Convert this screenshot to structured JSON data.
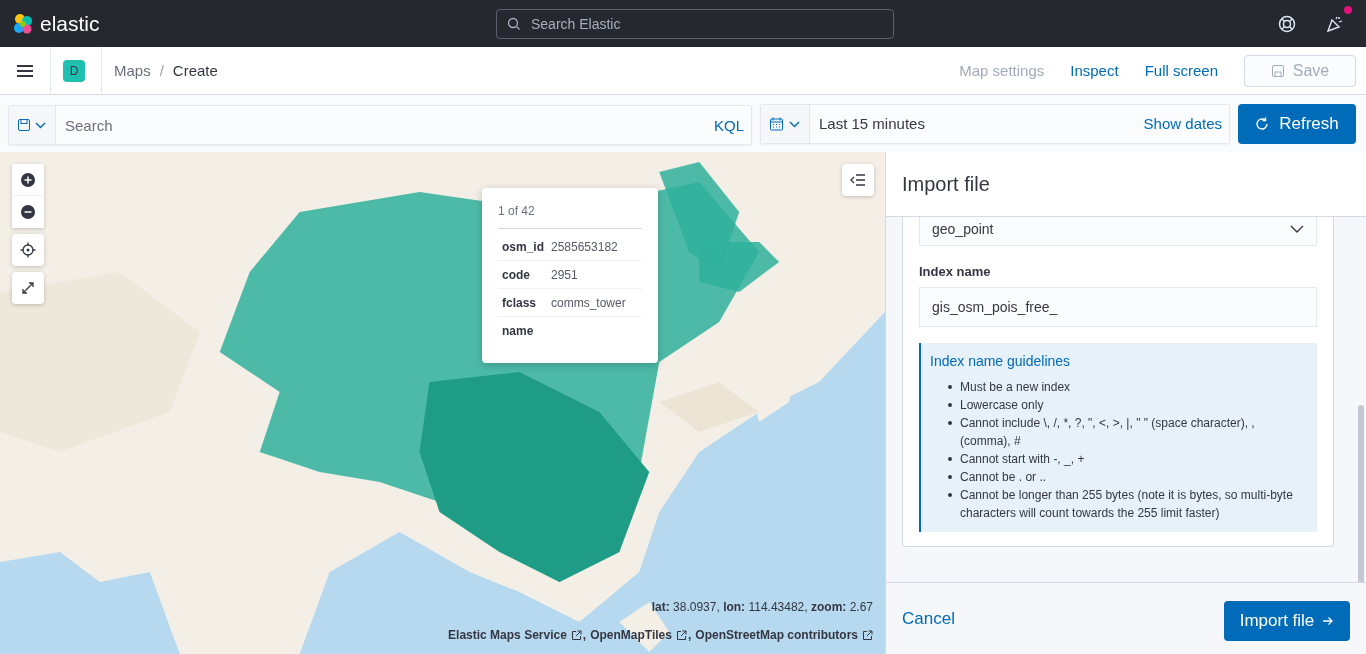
{
  "header": {
    "logo_text": "elastic",
    "search": {
      "placeholder": "Search Elastic"
    },
    "news_unread": true
  },
  "nav": {
    "space_initial": "D",
    "breadcrumb_separator": "/",
    "breadcrumbs": [
      {
        "label": "Maps",
        "current": false
      },
      {
        "label": "Create",
        "current": true
      }
    ],
    "actions": [
      {
        "label": "Map settings",
        "disabled": true
      },
      {
        "label": "Inspect",
        "disabled": false
      },
      {
        "label": "Full screen",
        "disabled": false
      }
    ],
    "save": {
      "label": "Save",
      "disabled": true
    }
  },
  "query_bar": {
    "search": {
      "placeholder": "Search"
    },
    "language": "KQL",
    "time_range": "Last 15 minutes",
    "show_dates": "Show dates",
    "refresh": "Refresh"
  },
  "map": {
    "kind": "picture",
    "tooltip": {
      "pager": "1 of 42",
      "rows": [
        {
          "field": "osm_id",
          "value": "2585653182"
        },
        {
          "field": "code",
          "value": "2951"
        },
        {
          "field": "fclass",
          "value": "comms_tower"
        },
        {
          "field": "name",
          "value": ""
        }
      ]
    },
    "coordinates": "**lat:** 38.0937, **lon:** 114.43482, **zoom:** 2.67",
    "attribution_separator": ",",
    "attribution": [
      "Elastic Maps Service",
      "OpenMapTiles",
      "OpenStreetMap contributors"
    ]
  },
  "panel": {
    "title": "Import file",
    "geo_type": "geo_point",
    "index_label": "Index name",
    "index_value": "gis_osm_pois_free_",
    "guidelines": {
      "title": "Index name guidelines",
      "items": [
        "Must be a new index",
        "Lowercase only",
        "Cannot include \\, /, *, ?, \", <, >, |, \" \" (space character), , (comma), #",
        "Cannot start with -, _, +",
        "Cannot be . or ..",
        "Cannot be longer than 255 bytes (note it is bytes, so multi-byte characters will count towards the 255 limit faster)"
      ]
    },
    "cancel": "Cancel",
    "submit": "Import file"
  }
}
